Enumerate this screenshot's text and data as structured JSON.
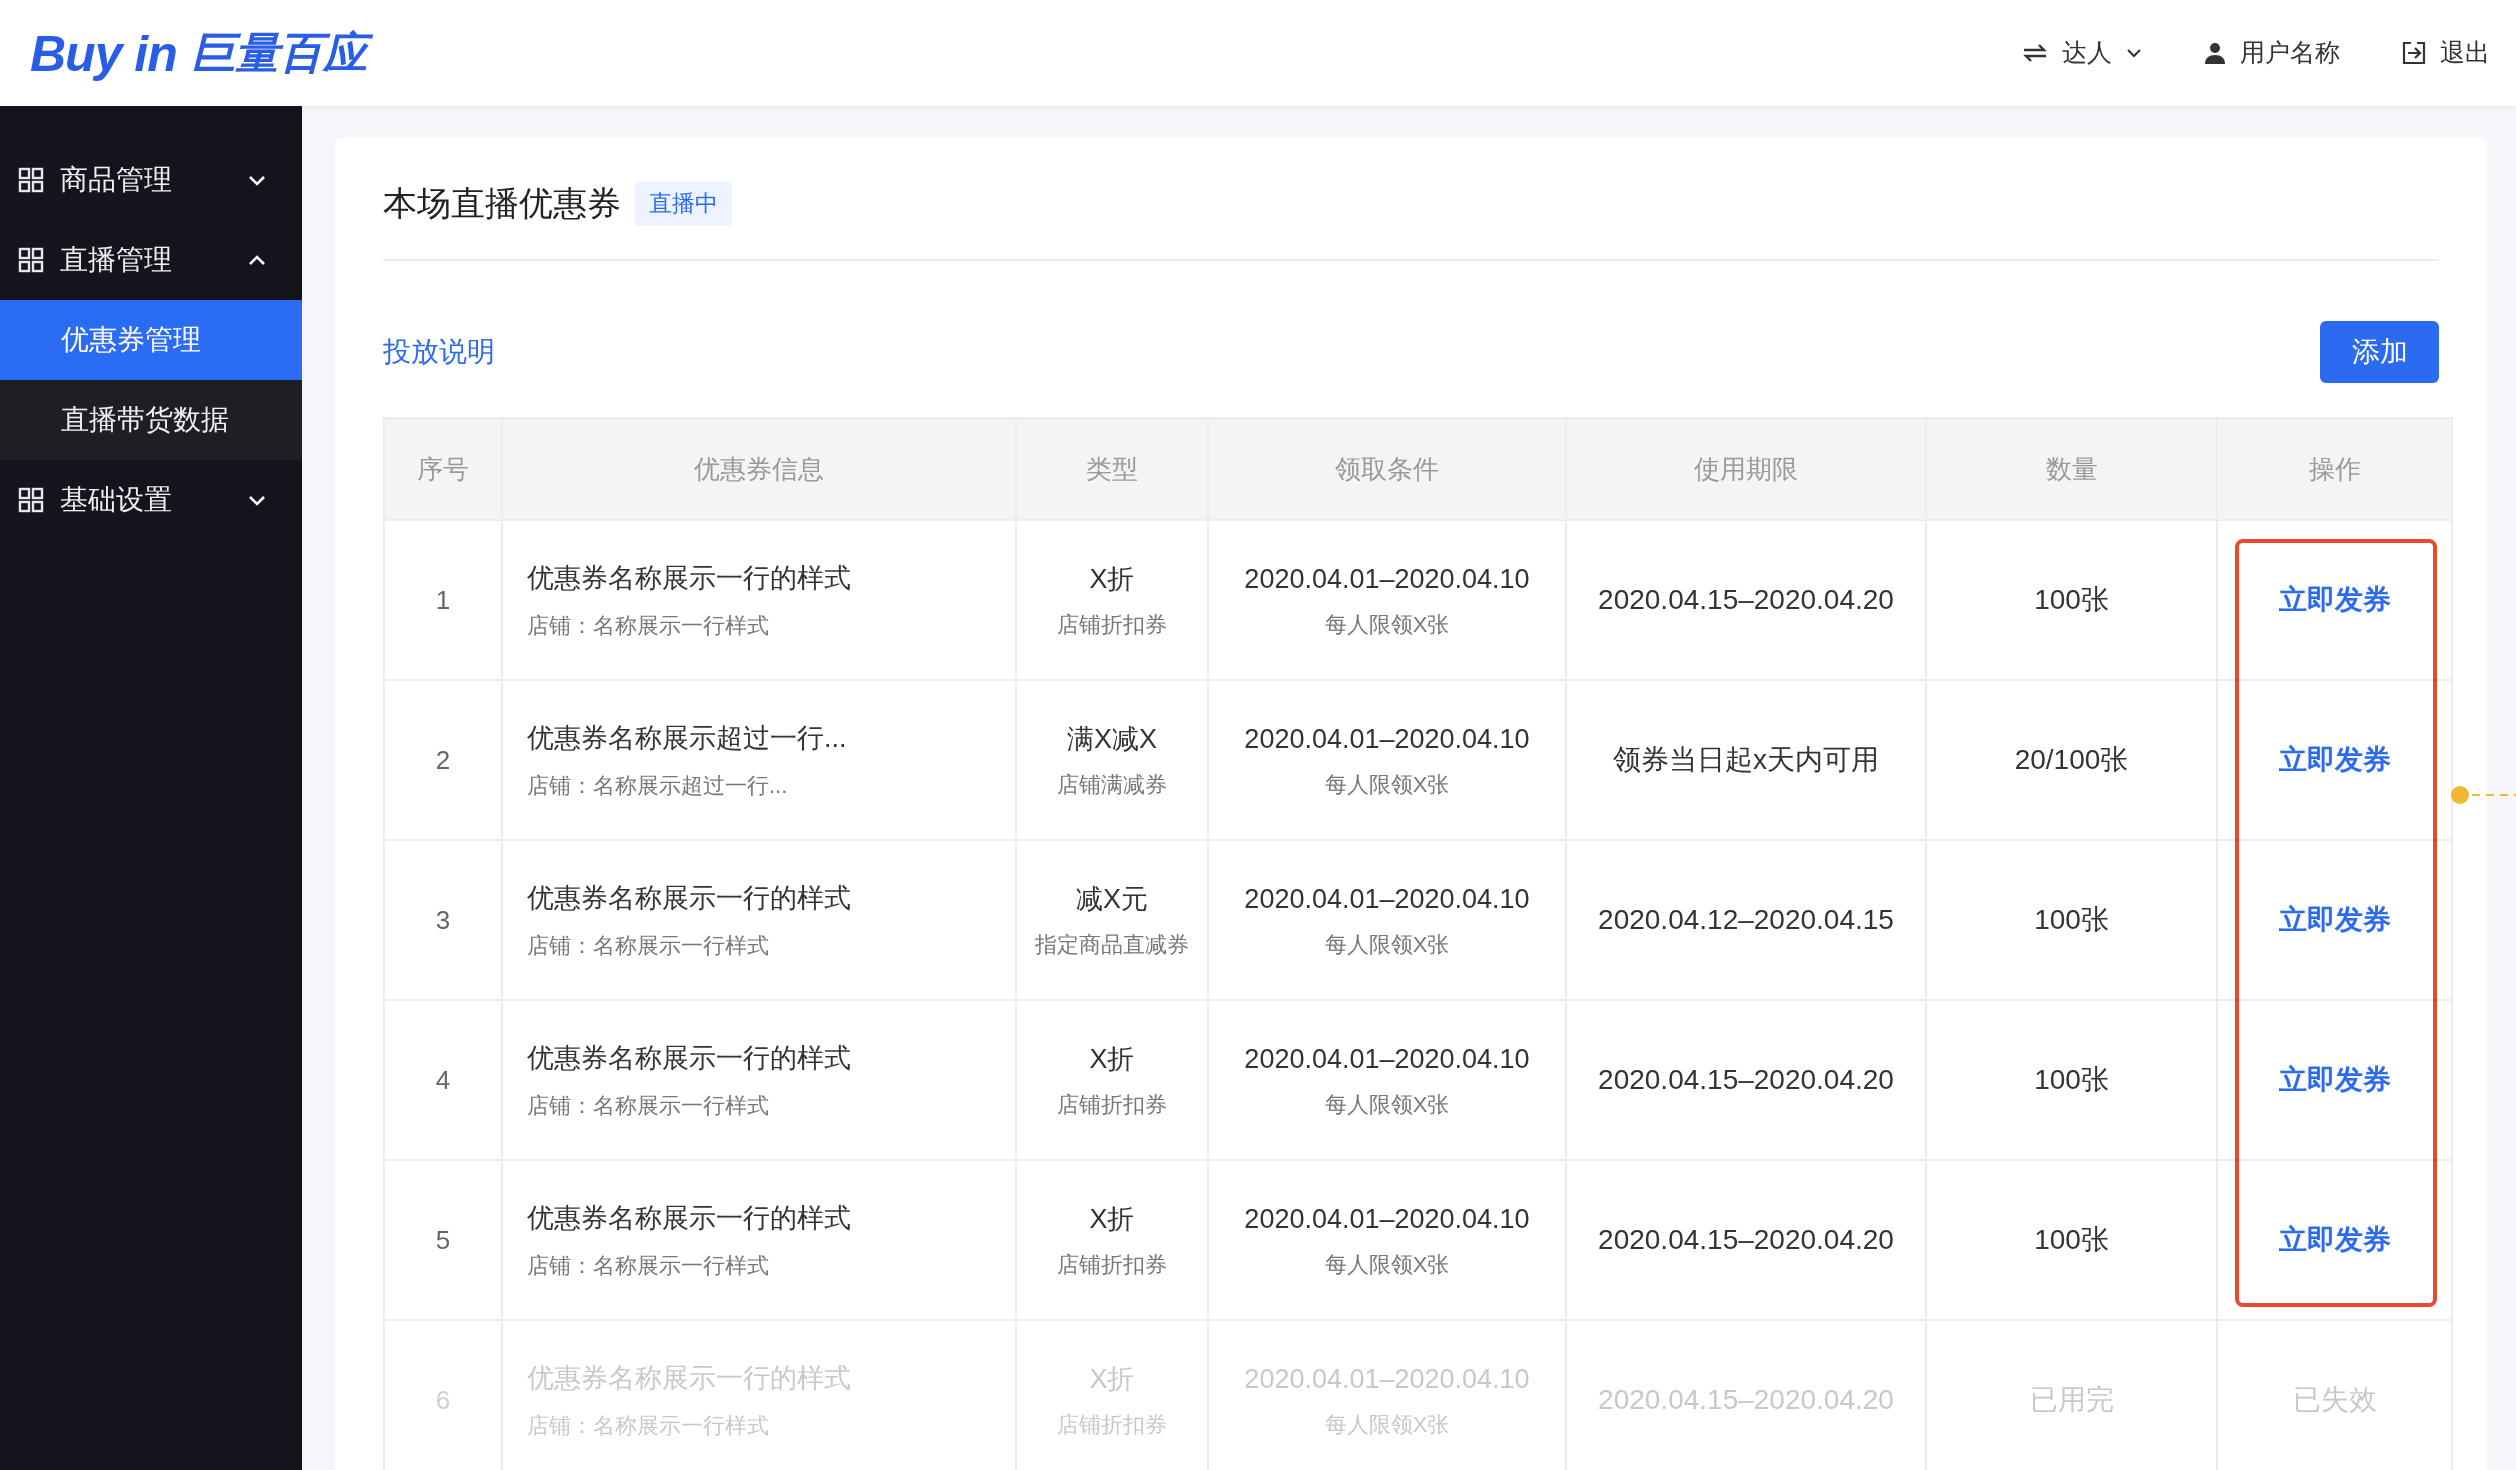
{
  "logo": {
    "latin": "Buy in",
    "chinese": "巨量百应"
  },
  "header_menu": [
    {
      "kind": "role",
      "label": "达人"
    },
    {
      "kind": "user",
      "label": "用户名称"
    },
    {
      "kind": "logout",
      "label": "退出"
    }
  ],
  "sidebar": {
    "items": [
      {
        "label": "商品管理",
        "expanded": false
      },
      {
        "label": "直播管理",
        "expanded": true,
        "children": [
          {
            "label": "优惠券管理",
            "selected": true
          },
          {
            "label": "直播带货数据",
            "selected": false
          }
        ]
      },
      {
        "label": "基础设置",
        "expanded": false
      }
    ]
  },
  "page": {
    "title": "本场直播优惠券",
    "status_badge": "直播中",
    "help_link": "投放说明",
    "add_button": "添加"
  },
  "table": {
    "columns": [
      "序号",
      "优惠券信息",
      "类型",
      "领取条件",
      "使用期限",
      "数量",
      "操作"
    ],
    "rows": [
      {
        "index": "1",
        "name": "优惠券名称展示一行的样式",
        "shop": "店铺：名称展示一行样式",
        "type": "X折",
        "type_detail": "店铺折扣券",
        "condition": "2020.04.01–2020.04.10",
        "condition_detail": "每人限领X张",
        "period": "2020.04.15–2020.04.20",
        "quantity": "100张",
        "action": {
          "kind": "link",
          "text": "立即发券"
        },
        "disabled": false
      },
      {
        "index": "2",
        "name": "优惠券名称展示超过一行...",
        "shop": "店铺：名称展示超过一行...",
        "type": "满X减X",
        "type_detail": "店铺满减券",
        "condition": "2020.04.01–2020.04.10",
        "condition_detail": "每人限领X张",
        "period": "领券当日起x天内可用",
        "quantity": "20/100张",
        "action": {
          "kind": "link",
          "text": "立即发券"
        },
        "disabled": false
      },
      {
        "index": "3",
        "name": "优惠券名称展示一行的样式",
        "shop": "店铺：名称展示一行样式",
        "type": "减X元",
        "type_detail": "指定商品直减券",
        "condition": "2020.04.01–2020.04.10",
        "condition_detail": "每人限领X张",
        "period": "2020.04.12–2020.04.15",
        "quantity": "100张",
        "action": {
          "kind": "link",
          "text": "立即发券"
        },
        "disabled": false
      },
      {
        "index": "4",
        "name": "优惠券名称展示一行的样式",
        "shop": "店铺：名称展示一行样式",
        "type": "X折",
        "type_detail": "店铺折扣券",
        "condition": "2020.04.01–2020.04.10",
        "condition_detail": "每人限领X张",
        "period": "2020.04.15–2020.04.20",
        "quantity": "100张",
        "action": {
          "kind": "link",
          "text": "立即发券"
        },
        "disabled": false
      },
      {
        "index": "5",
        "name": "优惠券名称展示一行的样式",
        "shop": "店铺：名称展示一行样式",
        "type": "X折",
        "type_detail": "店铺折扣券",
        "condition": "2020.04.01–2020.04.10",
        "condition_detail": "每人限领X张",
        "period": "2020.04.15–2020.04.20",
        "quantity": "100张",
        "action": {
          "kind": "link",
          "text": "立即发券"
        },
        "disabled": false
      },
      {
        "index": "6",
        "name": "优惠券名称展示一行的样式",
        "shop": "店铺：名称展示一行样式",
        "type": "X折",
        "type_detail": "店铺折扣券",
        "condition": "2020.04.01–2020.04.10",
        "condition_detail": "每人限领X张",
        "period": "2020.04.15–2020.04.20",
        "quantity": "已用完",
        "action": {
          "kind": "status",
          "text": "已失效"
        },
        "disabled": true
      }
    ]
  }
}
